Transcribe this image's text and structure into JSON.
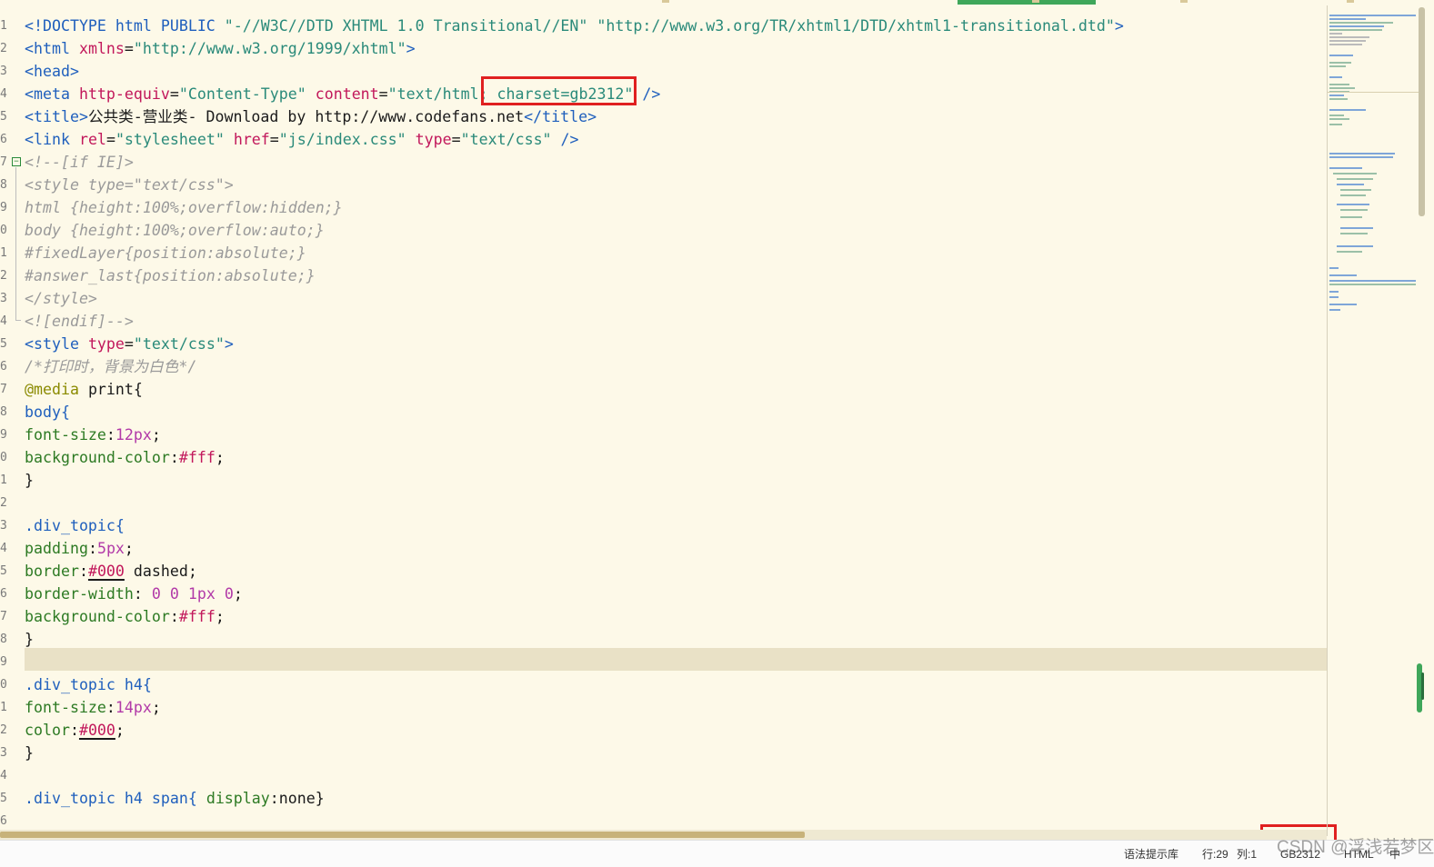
{
  "editor": {
    "line_numbers": [
      "1",
      "2",
      "3",
      "4",
      "5",
      "6",
      "7",
      "8",
      "9",
      "0",
      "1",
      "2",
      "3",
      "4",
      "5",
      "6",
      "7",
      "8",
      "9",
      "0",
      "1",
      "2",
      "3",
      "4",
      "5",
      "6",
      "7",
      "8",
      "9",
      "0",
      "1",
      "2",
      "3",
      "4",
      "5",
      "6"
    ],
    "code": {
      "l1_a": "<!DOCTYPE html PUBLIC ",
      "l1_b": "\"-//W3C//DTD XHTML 1.0 Transitional//EN\"",
      "l1_c": " ",
      "l1_d": "\"http://www.w3.org/TR/xhtml1/DTD/xhtml1-transitional.dtd\"",
      "l1_e": ">",
      "l2_a": "<html ",
      "l2_b": "xmlns",
      "l2_c": "=",
      "l2_d": "\"http://www.w3.org/1999/xhtml\"",
      "l2_e": ">",
      "l3": "<head>",
      "l4_a": "<meta ",
      "l4_b": "http-equiv",
      "l4_c": "=",
      "l4_d": "\"Content-Type\"",
      "l4_e": " ",
      "l4_f": "content",
      "l4_g": "=",
      "l4_h": "\"text/html; charset=gb2312\"",
      "l4_i": " />",
      "l5_a": "<title>",
      "l5_b": "公共类-营业类- Download by http://www.codefans.net",
      "l5_c": "</title>",
      "l6_a": "<link ",
      "l6_b": "rel",
      "l6_c": "=",
      "l6_d": "\"stylesheet\"",
      "l6_e": " ",
      "l6_f": "href",
      "l6_g": "=",
      "l6_h": "\"js/index.css\"",
      "l6_i": " ",
      "l6_j": "type",
      "l6_k": "=",
      "l6_l": "\"text/css\"",
      "l6_m": " />",
      "l7": "<!--[if IE]>",
      "l8": "<style type=\"text/css\">",
      "l9": "html {height:100%;overflow:hidden;}",
      "l10": "body {height:100%;overflow:auto;}",
      "l11": "#fixedLayer{position:absolute;}",
      "l12": "#answer_last{position:absolute;}",
      "l13": "</style>",
      "l14": "<![endif]-->",
      "l15_a": "<style ",
      "l15_b": "type",
      "l15_c": "=",
      "l15_d": "\"text/css\"",
      "l15_e": ">",
      "l16": "/*打印时，背景为白色*/",
      "l17_a": "@media",
      "l17_b": " print{",
      "l18": "body{",
      "l19_a": "font-size",
      "l19_b": ":",
      "l19_c": "12",
      "l19_d": "px",
      "l19_e": ";",
      "l20_a": "background-color",
      "l20_b": ":",
      "l20_c": "#fff",
      "l20_d": ";",
      "l21": "}",
      "l23": ".div_topic{",
      "l24_a": "padding",
      "l24_b": ":",
      "l24_c": "5",
      "l24_d": "px",
      "l24_e": ";",
      "l25_a": "border",
      "l25_b": ":",
      "l25_c": "#000",
      "l25_d": " dashed;",
      "l26_a": "border-width",
      "l26_b": ": ",
      "l26_c": "0",
      "l26_d": " ",
      "l26_e": "0",
      "l26_f": " ",
      "l26_g": "1",
      "l26_h": "px",
      "l26_i": " ",
      "l26_j": "0",
      "l26_k": ";",
      "l27_a": "background-color",
      "l27_b": ":",
      "l27_c": "#fff",
      "l27_d": ";",
      "l28": "}",
      "l30_a": ".div_topic",
      "l30_b": " h4",
      "l30_c": "{",
      "l31_a": "font-size",
      "l31_b": ":",
      "l31_c": "14",
      "l31_d": "px",
      "l31_e": ";",
      "l32_a": "color",
      "l32_b": ":",
      "l32_c": "#000",
      "l32_d": ";",
      "l33": "}",
      "l35_a": ".div_topic",
      "l35_b": " h4 span",
      "l35_c": "{ ",
      "l35_d": "display",
      "l35_e": ":",
      "l35_f": "none}"
    }
  },
  "statusbar": {
    "syntax_hint": "语法提示库",
    "line": "行:29",
    "col": "列:1",
    "encoding": "GB2312",
    "type": "HTML",
    "extra": "中"
  },
  "watermark": "CSDN @浮浅若梦区",
  "colors": {
    "background": "#fdf9e8",
    "highlight_line": "#e9e1c6",
    "annotation_box": "#e02020",
    "tab_active": "#3fa75a"
  }
}
